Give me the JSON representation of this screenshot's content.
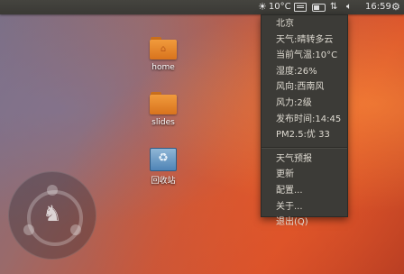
{
  "panel": {
    "temperature": "10°C",
    "clock": "16:59",
    "icons": [
      "sun-icon",
      "keyboard-icon",
      "battery-icon",
      "network-icon",
      "volume-icon",
      "gear-icon"
    ]
  },
  "desktop": {
    "icons": [
      {
        "label": "home"
      },
      {
        "label": "slides"
      },
      {
        "label": "回收站"
      }
    ]
  },
  "weather_menu": {
    "city": "北京",
    "condition": "天气:晴转多云",
    "current_temp": "当前气温:10°C",
    "humidity": "湿度:26%",
    "wind_direction": "风向:西南风",
    "wind_force": "风力:2级",
    "publish_time": "发布时间:14:45",
    "pm25": "PM2.5:优 33",
    "actions": {
      "forecast": "天气预报",
      "update": "更新",
      "configure": "配置...",
      "about": "关于...",
      "quit": "退出(Q)"
    }
  }
}
